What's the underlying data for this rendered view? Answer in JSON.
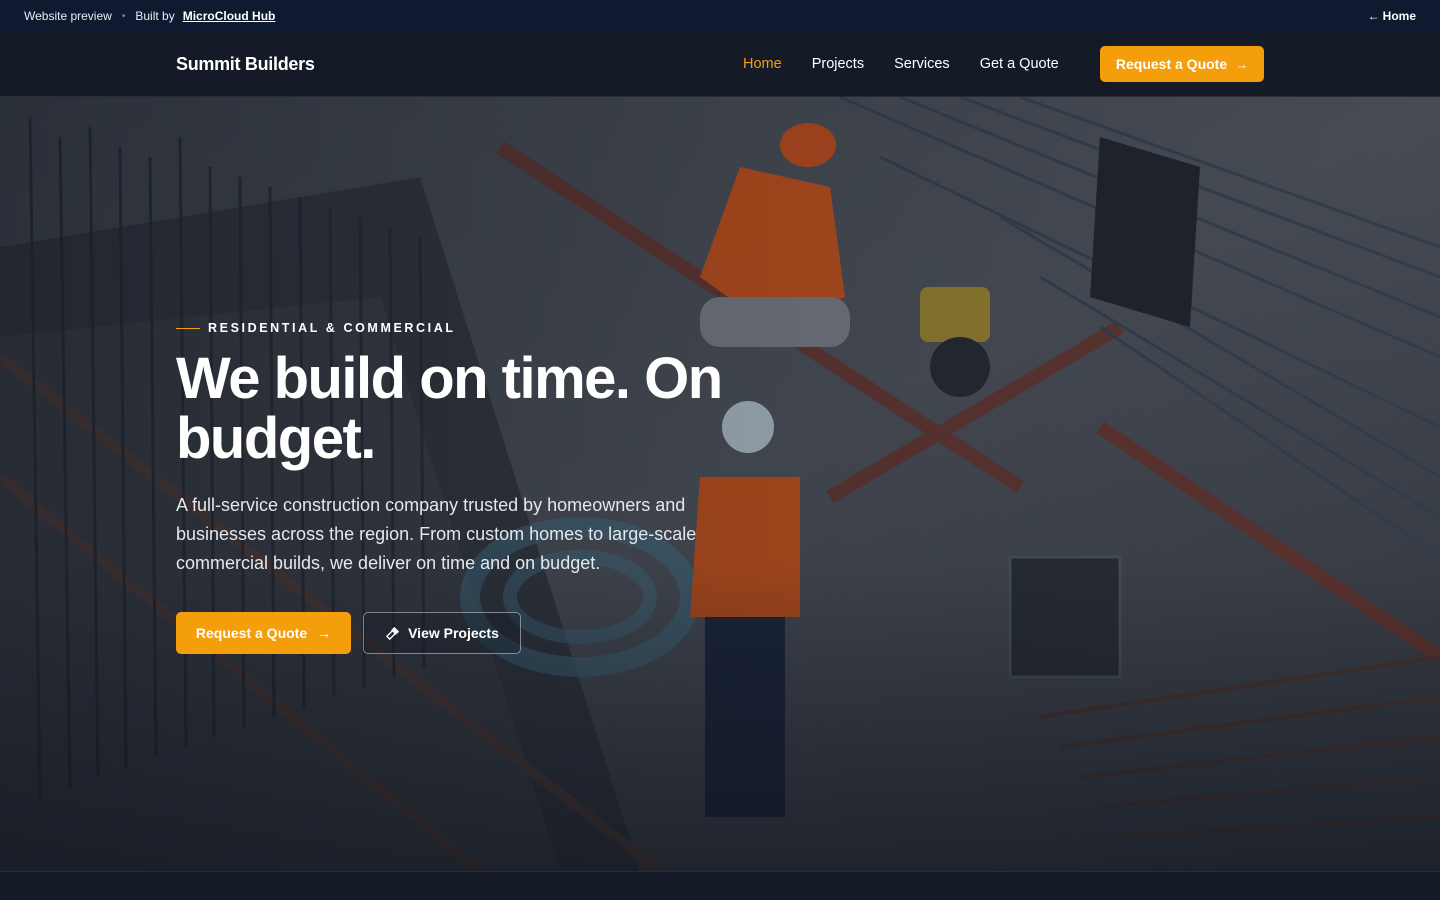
{
  "preview_bar": {
    "label": "Website preview",
    "built_by": "Built by",
    "builder": "MicroCloud Hub",
    "home": "Home"
  },
  "nav": {
    "brand": "Summit Builders",
    "links": [
      "Home",
      "Projects",
      "Services",
      "Get a Quote"
    ],
    "active": "Home",
    "cta": "Request a Quote"
  },
  "hero": {
    "eyebrow": "RESIDENTIAL & COMMERCIAL",
    "headline": "We build on time. On budget.",
    "subtext": "A full-service construction company trusted by homeowners and businesses across the region. From custom homes to large-scale commercial builds, we deliver on time and on budget.",
    "primary_cta": "Request a Quote",
    "secondary_cta": "View Projects",
    "background": "construction-site-photo"
  },
  "colors": {
    "accent": "#f59e0b",
    "nav_bg": "#151b26",
    "preview_bg": "#0f1a30"
  }
}
